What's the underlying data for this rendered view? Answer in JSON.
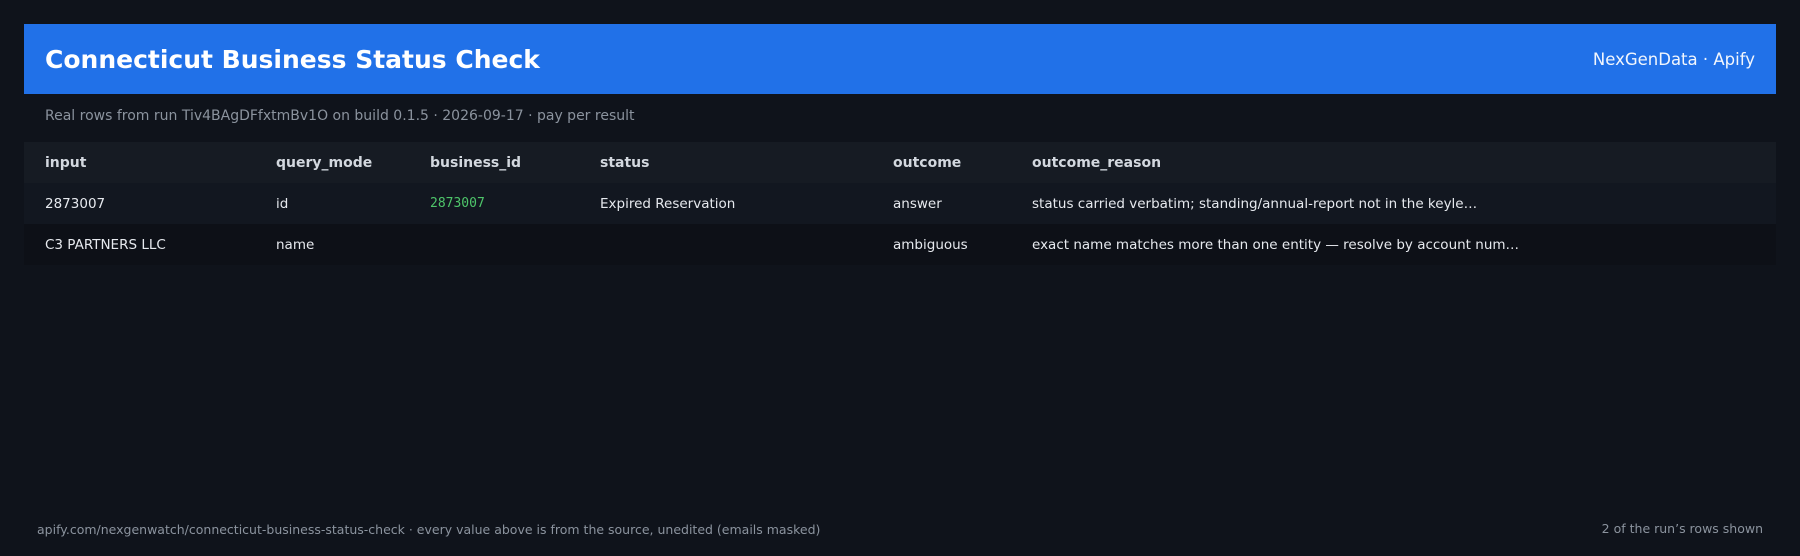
{
  "header": {
    "title": "Connecticut Business Status Check",
    "brand": "NexGenData · Apify"
  },
  "subtitle": "Real rows from run Tiv4BAgDFfxtmBv1O on build 0.1.5 · 2026-09-17 · pay per result",
  "table": {
    "columns": [
      "input",
      "query_mode",
      "business_id",
      "status",
      "outcome",
      "outcome_reason"
    ],
    "rows": [
      {
        "input": "2873007",
        "query_mode": "id",
        "business_id": "2873007",
        "status": "Expired Reservation",
        "outcome": "answer",
        "outcome_reason": "status carried verbatim; standing/annual-report not in the keyle…"
      },
      {
        "input": "C3 PARTNERS LLC",
        "query_mode": "name",
        "business_id": "",
        "status": "",
        "outcome": "ambiguous",
        "outcome_reason": "exact name matches more than one entity — resolve by account num…"
      }
    ]
  },
  "footer": {
    "source": "apify.com/nexgenwatch/connecticut-business-status-check  ·  every value above is from the source, unedited (emails masked)",
    "count": "2 of the run’s rows shown"
  },
  "colors": {
    "background": "#0f131b",
    "header": "#2171e8",
    "id_text": "#4ec56a"
  }
}
